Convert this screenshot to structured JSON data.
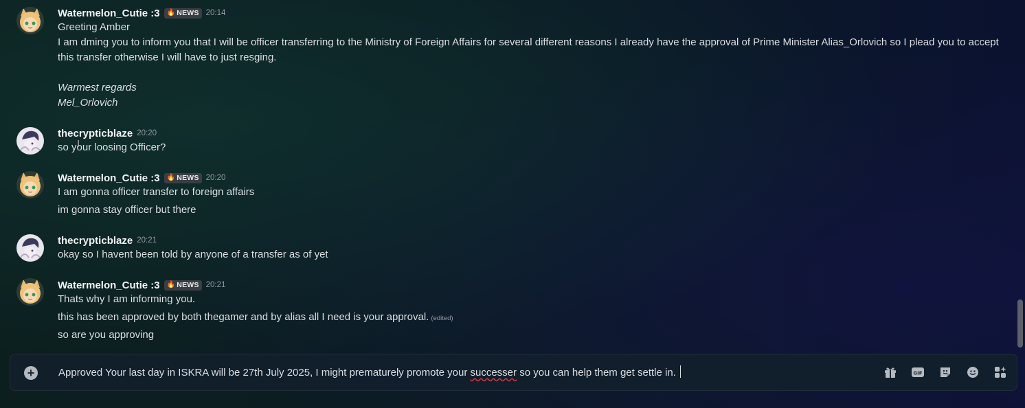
{
  "messages": [
    {
      "username": "Watermelon_Cutie :3",
      "tag": "NEWS",
      "time": "20:14",
      "lines": [
        "Greeting Amber",
        "I am dming  you to inform you that I will be officer transferring to the Ministry of Foreign Affairs for several different reasons I already have the approval of Prime Minister Alias_Orlovich so I plead you to accept this transfer otherwise I will have to just resging.",
        "Warmest regards",
        "Mel_Orlovich"
      ]
    },
    {
      "username": "thecrypticblaze",
      "time": "20:20",
      "lines": [
        "so your loosing Officer?"
      ]
    },
    {
      "username": "Watermelon_Cutie :3",
      "tag": "NEWS",
      "time": "20:20",
      "lines": [
        "I am gonna officer transfer to foreign affairs",
        "im gonna stay officer but there"
      ]
    },
    {
      "username": "thecrypticblaze",
      "time": "20:21",
      "lines": [
        "okay so I havent been told by anyone of a transfer as of yet"
      ]
    },
    {
      "username": "Watermelon_Cutie :3",
      "tag": "NEWS",
      "time": "20:21",
      "lines": [
        "Thats why I am informing you.",
        "this has been approved by both thegamer and by alias all I need is your approval.",
        "so are you approving"
      ],
      "edited_label": "(edited)"
    }
  ],
  "composer": {
    "text_before": "Approved Your last day in ISKRA will be 27th July 2025, I might prematurely promote your ",
    "misspelled_word": "successer",
    "text_after": " so you can help them get settle in.",
    "icons": [
      "gift-icon",
      "gif-icon",
      "sticker-icon",
      "emoji-icon",
      "apps-icon"
    ]
  },
  "colors": {
    "username": "#f2f3f5",
    "text": "#dbdee1",
    "timestamp": "#949ba4",
    "tag_bg": "#3a3d44"
  }
}
